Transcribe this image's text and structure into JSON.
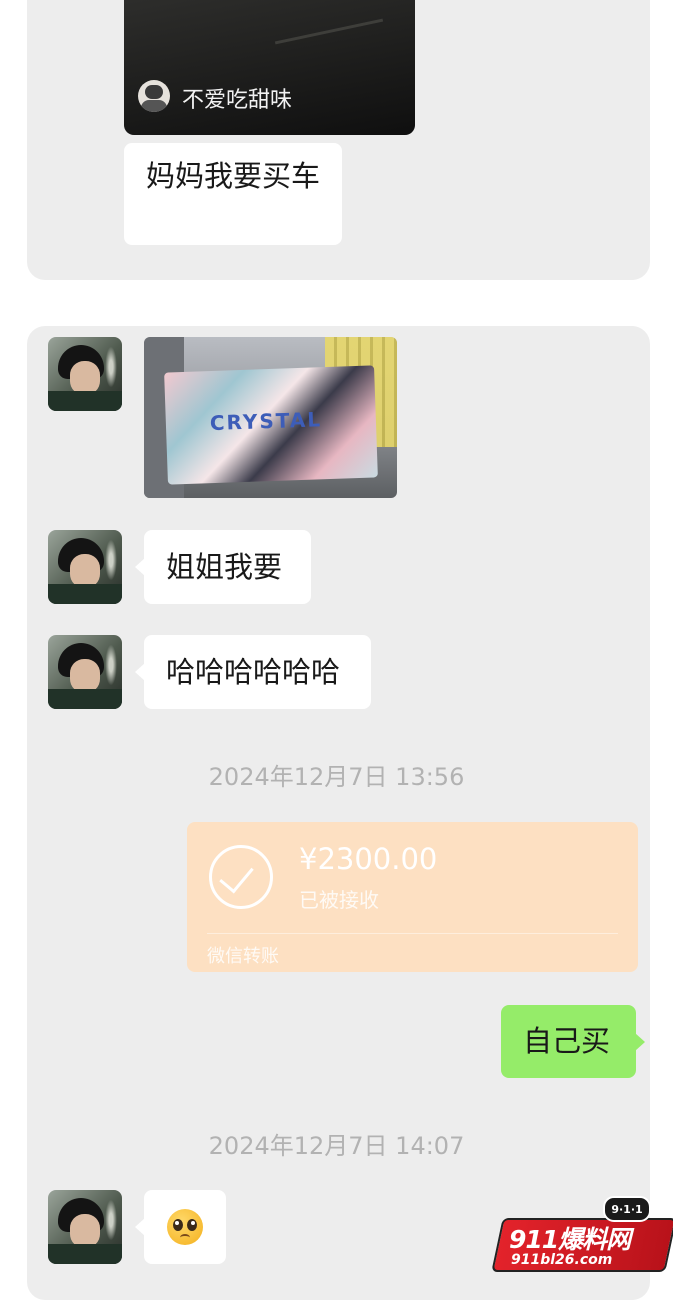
{
  "top_panel": {
    "video_card": {
      "author": "不爱吃甜味"
    },
    "message": "妈妈我要买车"
  },
  "chat": {
    "photo": {
      "box_text": "CRYSTAL"
    },
    "messages": [
      {
        "text": "姐姐我要"
      },
      {
        "text": "哈哈哈哈哈哈"
      }
    ],
    "timestamp_1": "2024年12月7日 13:56",
    "transfer": {
      "amount": "¥2300.00",
      "status": "已被接收",
      "footer": "微信转账"
    },
    "self_message": "自己买",
    "timestamp_2": "2024年12月7日 14:07",
    "last_message_icon": "pleading-face-emoji"
  },
  "watermark": {
    "badge": "9·1·1",
    "logo": "911爆料网",
    "url": "911bl26.com"
  },
  "colors": {
    "chat_bg": "#ededed",
    "bubble_white": "#ffffff",
    "bubble_green": "#95ec69",
    "transfer_orange": "#fde0c2",
    "timestamp_gray": "#b2b2b2"
  }
}
